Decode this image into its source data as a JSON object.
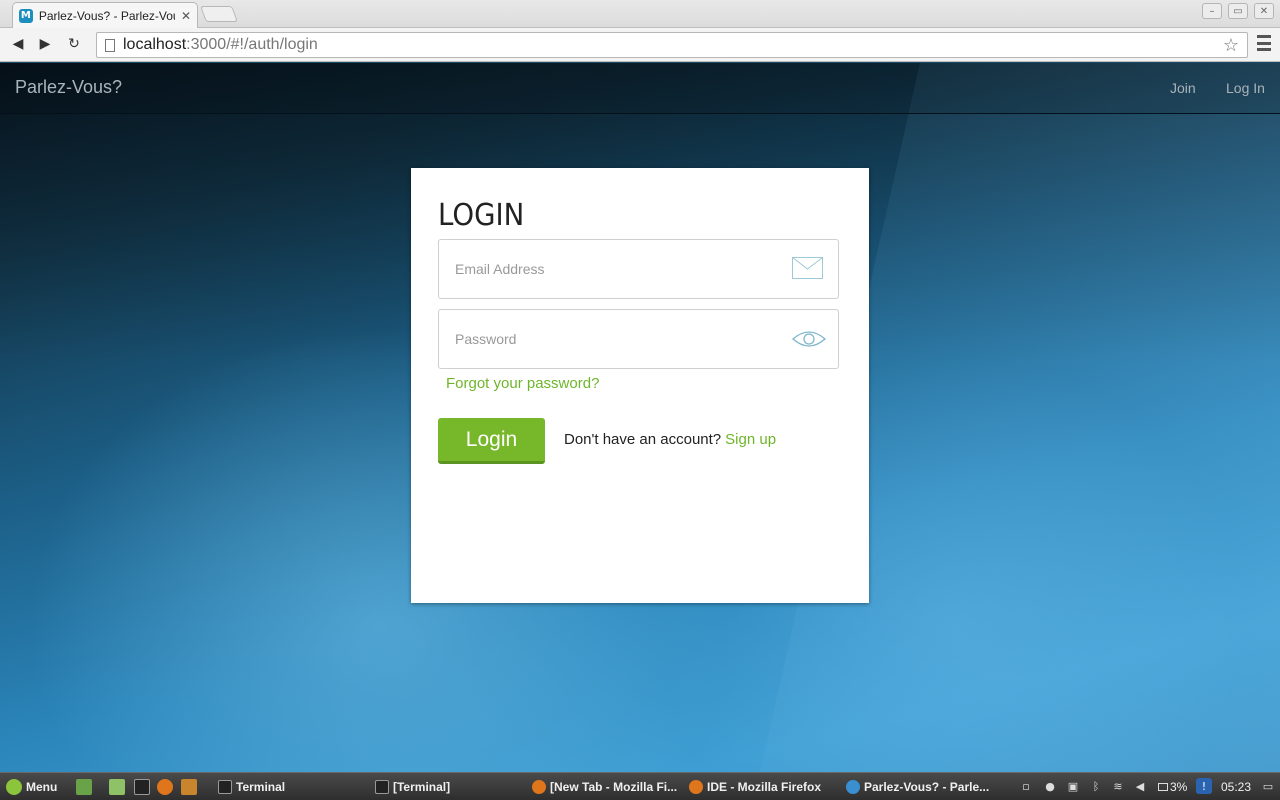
{
  "browser": {
    "tab_title": "Parlez-Vous? - Parlez-Vou",
    "tab_favicon_letter": "M",
    "url_host": "localhost",
    "url_path": ":3000/#!/auth/login"
  },
  "app": {
    "brand": "Parlez-Vous?",
    "nav": {
      "join": "Join",
      "login": "Log In"
    }
  },
  "login": {
    "title": "LOGIN",
    "email_placeholder": "Email Address",
    "password_placeholder": "Password",
    "forgot": "Forgot your password?",
    "button": "Login",
    "no_account": "Don't have an account?",
    "signup": "Sign up"
  },
  "taskbar": {
    "menu": "Menu",
    "items": [
      "Terminal",
      "[Terminal]",
      "[New Tab - Mozilla Fi...",
      "IDE - Mozilla Firefox",
      "Parlez-Vous? - Parle..."
    ],
    "battery": "3%",
    "clock": "05:23"
  },
  "colors": {
    "accent_green": "#77b82a",
    "link_green": "#6fb52c"
  }
}
